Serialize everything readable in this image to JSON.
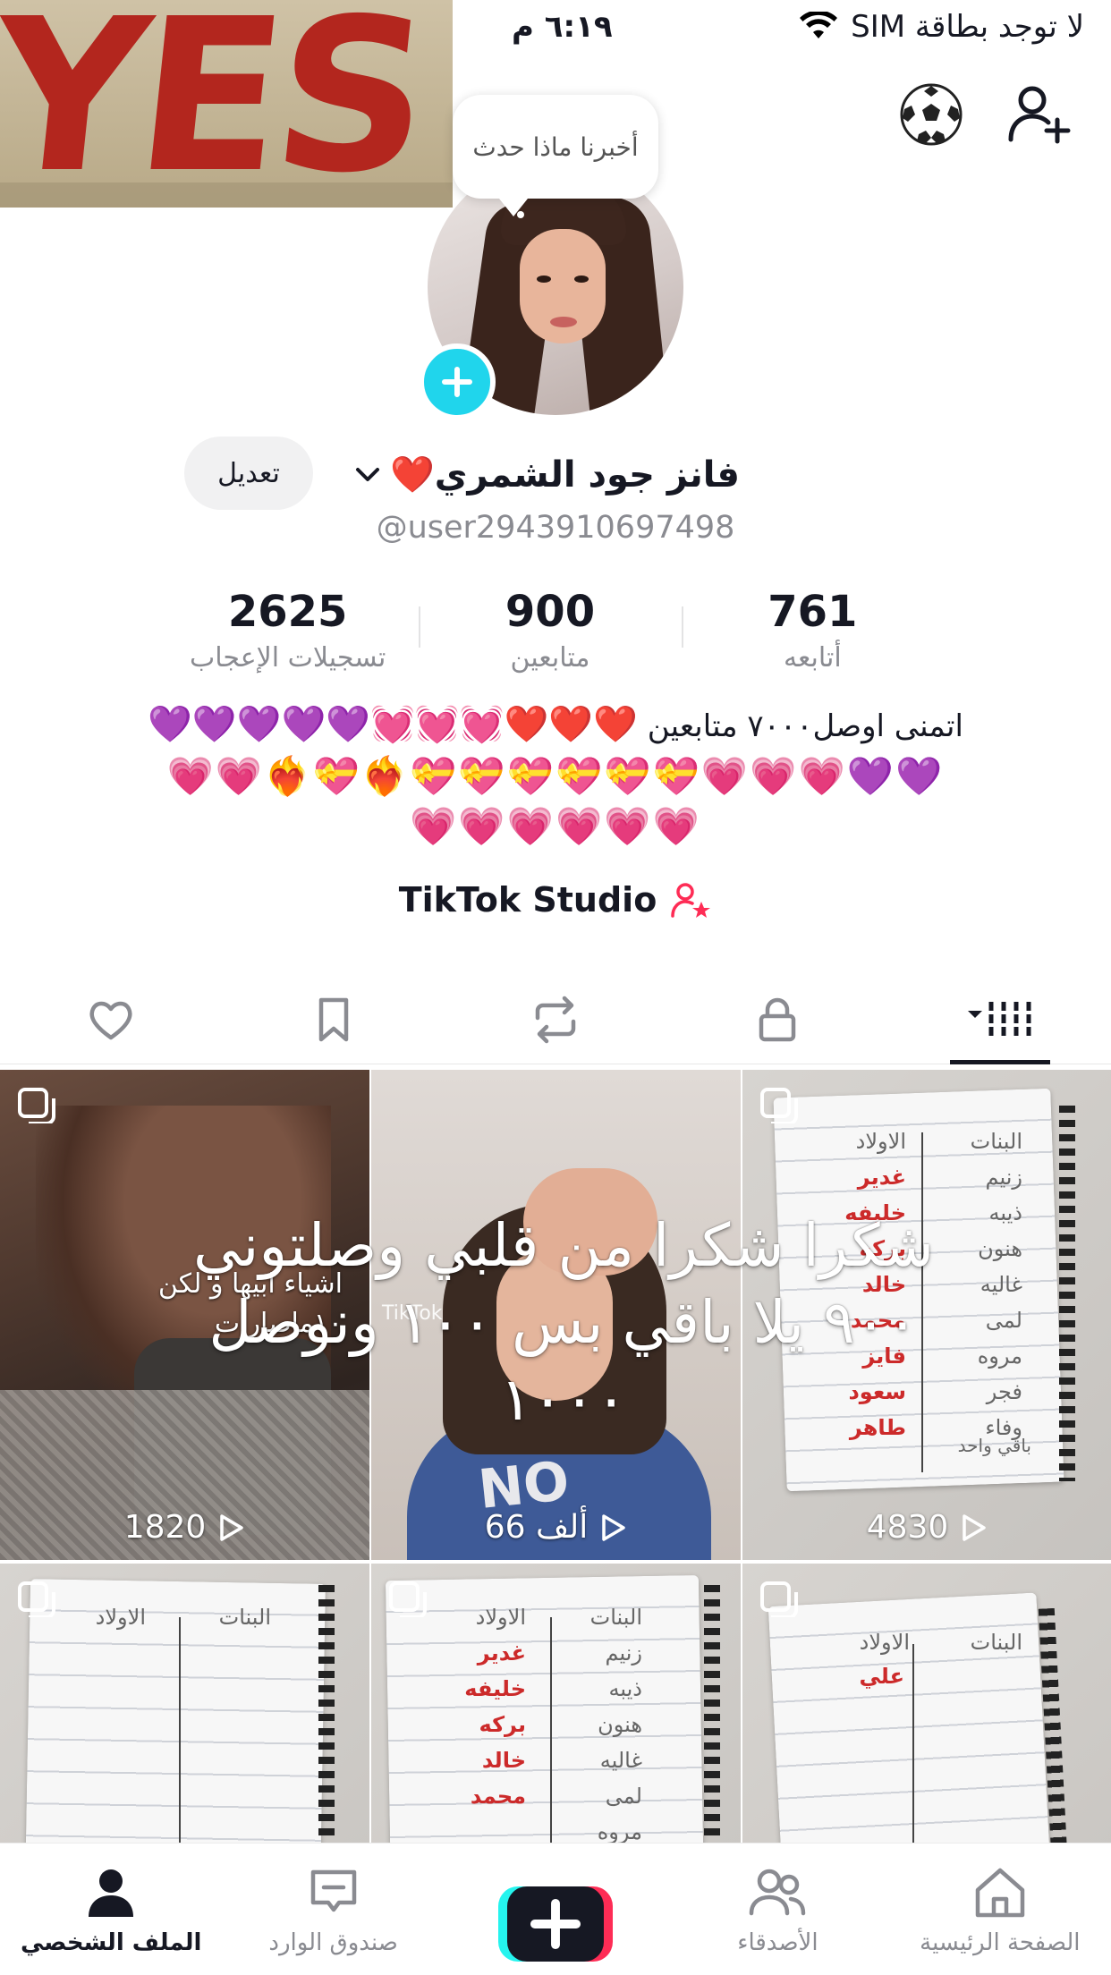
{
  "status_bar": {
    "carrier": "لا توجد بطاقة SIM",
    "time": "٦:١٩ م"
  },
  "cover_sticker": {
    "text": "YES !"
  },
  "profile": {
    "bubble_prompt": "أخبرنا ماذا حدث",
    "display_name": "فانز جود الشمري❤️",
    "username": "@user2943910697498",
    "edit_label": "تعديل"
  },
  "stats": [
    {
      "value": "2625",
      "label": "تسجيلات الإعجاب"
    },
    {
      "value": "900",
      "label": "متابعين"
    },
    {
      "value": "761",
      "label": "أتابعه"
    }
  ],
  "bio": {
    "line1_text": "اتمنى اوصل٧٠٠٠ متابعين",
    "line1_emoji": "❤️❤️❤️💓💓💓💜💜💜💜💜",
    "line2_emoji": "💜💜💗💗💗💝💝💝💝💝💝❤️‍🔥💝❤️‍🔥💗💗",
    "line3_emoji": "💗💗💗💗💗💗"
  },
  "studio": {
    "label": "TikTok Studio"
  },
  "tabs": [
    {
      "name": "videos",
      "icon": "grid-icon"
    },
    {
      "name": "private",
      "icon": "lock-icon"
    },
    {
      "name": "reposts",
      "icon": "repost-icon"
    },
    {
      "name": "favorites",
      "icon": "bookmark-icon"
    },
    {
      "name": "liked",
      "icon": "heart-icon"
    }
  ],
  "videos": [
    {
      "views": "1820",
      "caption": "اشياء ابيها و لكن ١٠ماصارات"
    },
    {
      "views": "66 ألف",
      "watermark": "TikTok"
    },
    {
      "views": "4830"
    },
    {
      "views": ""
    },
    {
      "views": ""
    },
    {
      "views": ""
    }
  ],
  "notebook_words": {
    "girls_header": "البنات",
    "boys_header": "الاولاد",
    "girls": [
      "زنيم",
      "ذيبه",
      "هنون",
      "غاليه",
      "لمى",
      "مروه",
      "فجر",
      "وفاء"
    ],
    "boys": [
      "غدير",
      "خليفه",
      "بركه",
      "خالد",
      "محمد",
      "فايز",
      "سعود",
      "طاهر"
    ],
    "page_footer": "باقي واحد",
    "single_boy": "علي"
  },
  "overlay_caption": "شكرا شكرا من قلبي وصلتوني ٩٠٠ يلا باقي بس ١٠٠ ونوصل ١٠٠٠",
  "bottom_nav": [
    {
      "label": "الملف الشخصي",
      "icon": "profile-icon",
      "active": true
    },
    {
      "label": "صندوق الوارد",
      "icon": "inbox-icon",
      "active": false
    },
    {
      "label": "",
      "icon": "create-plus-icon",
      "active": false
    },
    {
      "label": "الأصدقاء",
      "icon": "friends-icon",
      "active": false
    },
    {
      "label": "الصفحة الرئيسية",
      "icon": "home-icon",
      "active": false
    }
  ],
  "colors": {
    "accent_cyan": "#20d5ec",
    "tiktok_red": "#fe2c55",
    "tiktok_cyan": "#25f4ee",
    "text_primary": "#161823",
    "text_secondary": "#8a8b91"
  }
}
